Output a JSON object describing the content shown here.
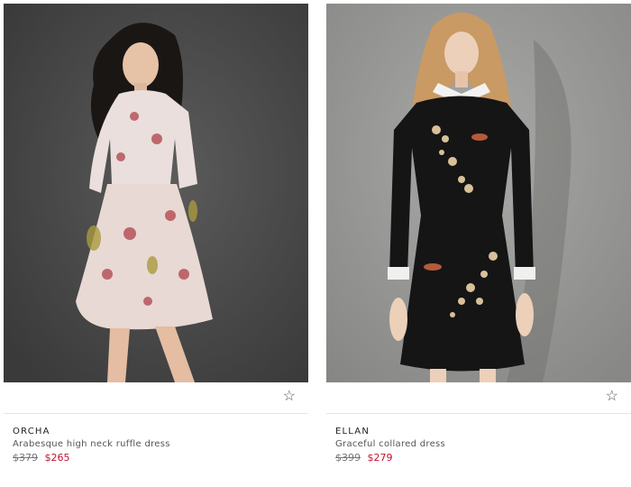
{
  "products": [
    {
      "brand": "ORCHA",
      "name": "Arabesque high neck ruffle dress",
      "old_price": "$379",
      "sale_price": "$265",
      "favorite_icon": "star-outline-icon"
    },
    {
      "brand": "ELLAN",
      "name": "Graceful collared dress",
      "old_price": "$399",
      "sale_price": "$279",
      "favorite_icon": "star-outline-icon"
    }
  ],
  "colors": {
    "sale_red": "#c4122f",
    "left_backdrop": "#4a4a4a",
    "right_backdrop": "#9a9a98"
  }
}
